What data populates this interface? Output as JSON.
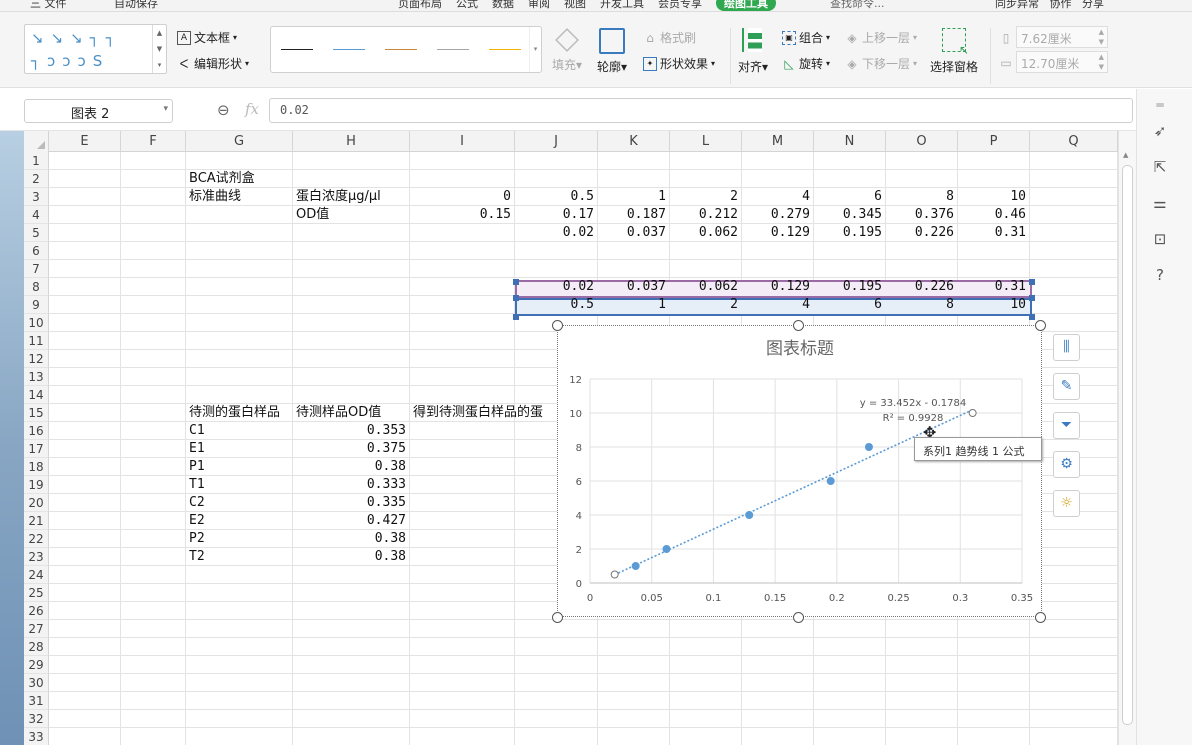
{
  "topbar": {
    "file_menu": "三 文件",
    "autosave": "自动保存",
    "tabs": [
      "页面布局",
      "公式",
      "数据",
      "审阅",
      "视图",
      "开发工具",
      "会员专享",
      "绘图工具"
    ],
    "search": "查找命令...",
    "sync": "同步异常",
    "collab": "协作",
    "share": "分享"
  },
  "ribbon": {
    "textbox": "文本框",
    "edit_shape": "编辑形状",
    "fill": "填充",
    "outline": "轮廓",
    "format_brush": "格式刷",
    "shape_effect": "形状效果",
    "align": "对齐",
    "group": "组合",
    "rotate": "旋转",
    "bring_forward": "上移一层",
    "send_backward": "下移一层",
    "selection_pane": "选择窗格",
    "height_value": "7.62厘米",
    "width_value": "12.70厘米",
    "line_colors": [
      "#222222",
      "#5b9bd5",
      "#c98a3e",
      "#a5a5a5",
      "#f2b400"
    ]
  },
  "formula_bar": {
    "name_box": "图表 2",
    "fx": "fx",
    "formula": "0.02"
  },
  "columns": [
    "E",
    "F",
    "G",
    "H",
    "I",
    "J",
    "K",
    "L",
    "M",
    "N",
    "O",
    "P",
    "Q"
  ],
  "rows": [
    "1",
    "2",
    "3",
    "4",
    "5",
    "6",
    "7",
    "8",
    "9",
    "10",
    "11",
    "12",
    "13",
    "14",
    "15",
    "16",
    "17",
    "18",
    "19",
    "20",
    "21",
    "22",
    "23",
    "24",
    "25",
    "26",
    "27",
    "28",
    "29",
    "30",
    "31",
    "32",
    "33"
  ],
  "sheet": {
    "g2": "BCA试剂盒",
    "g3": "标准曲线",
    "h3": "蛋白浓度μg/μl",
    "h4": "OD值",
    "row3_values": [
      "0",
      "0.5",
      "1",
      "2",
      "4",
      "6",
      "8",
      "10"
    ],
    "row4_values": [
      "0.15",
      "0.17",
      "0.187",
      "0.212",
      "0.279",
      "0.345",
      "0.376",
      "0.46"
    ],
    "row5_values": [
      "0.02",
      "0.037",
      "0.062",
      "0.129",
      "0.195",
      "0.226",
      "0.31"
    ],
    "row8_values": [
      "0.02",
      "0.037",
      "0.062",
      "0.129",
      "0.195",
      "0.226",
      "0.31"
    ],
    "row9_values": [
      "0.5",
      "1",
      "2",
      "4",
      "6",
      "8",
      "10"
    ],
    "g15": "待测的蛋白样品",
    "h15": "待测样品OD值",
    "i15": "得到待测蛋白样品的蛋",
    "samples": [
      {
        "name": "C1",
        "od": "0.353"
      },
      {
        "name": "E1",
        "od": "0.375"
      },
      {
        "name": "P1",
        "od": "0.38"
      },
      {
        "name": "T1",
        "od": "0.333"
      },
      {
        "name": "C2",
        "od": "0.335"
      },
      {
        "name": "E2",
        "od": "0.427"
      },
      {
        "name": "P2",
        "od": "0.38"
      },
      {
        "name": "T2",
        "od": "0.38"
      }
    ]
  },
  "tooltip": "系列1 趋势线 1 公式",
  "chart_data": {
    "type": "scatter",
    "title": "图表标题",
    "x": [
      0.02,
      0.037,
      0.062,
      0.129,
      0.195,
      0.226,
      0.31
    ],
    "y": [
      0.5,
      1,
      2,
      4,
      6,
      8,
      10
    ],
    "xlim": [
      0,
      0.35
    ],
    "ylim": [
      0,
      12
    ],
    "x_ticks": [
      "0",
      "0.05",
      "0.1",
      "0.15",
      "0.2",
      "0.25",
      "0.3",
      "0.35"
    ],
    "y_ticks": [
      "0",
      "2",
      "4",
      "6",
      "8",
      "10",
      "12"
    ],
    "trendline": {
      "slope": 33.452,
      "intercept": -0.1784,
      "type": "linear"
    },
    "equation": "y = 33.452x - 0.1784",
    "r2": "R² = 0.9928",
    "grid": true,
    "point_color": "#5b9bd5"
  }
}
